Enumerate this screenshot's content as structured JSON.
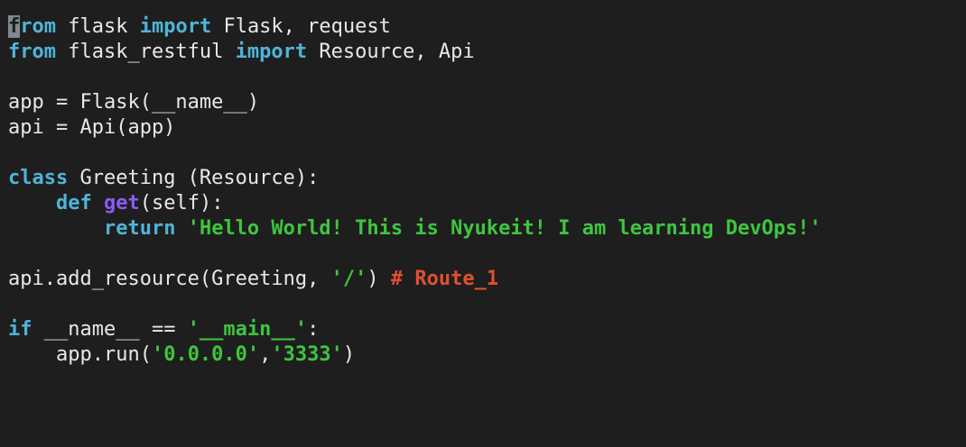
{
  "colors": {
    "background": "#1e1e1e",
    "keyword": "#4fb4d8",
    "function_name": "#8a5cf5",
    "string": "#3fc53f",
    "comment": "#e0502f",
    "text": "#e8e8e8",
    "cursor": "#7f8a8f"
  },
  "code": {
    "l1": {
      "cursor_char": "f",
      "kw1_rest": "rom",
      "t1": " flask ",
      "kw2": "import",
      "t2": " Flask, request"
    },
    "l2": {
      "kw1": "from",
      "t1": " flask_restful ",
      "kw2": "import",
      "t2": " Resource, Api"
    },
    "l4": {
      "t1": "app = Flask(__name__)"
    },
    "l5": {
      "t1": "api = Api(app)"
    },
    "l7": {
      "kw1": "class",
      "t1": " Greeting (Resource):"
    },
    "l8": {
      "indent": "    ",
      "kw1": "def",
      "sp": " ",
      "fn": "get",
      "t1": "(self):"
    },
    "l9": {
      "indent": "        ",
      "kw1": "return",
      "sp": " ",
      "str1": "'Hello World! This is Nyukeit! I am learning DevOps!'"
    },
    "l11": {
      "t1": "api.add_resource(Greeting, ",
      "str1": "'/'",
      "t2": ") ",
      "cm": "# Route_1"
    },
    "l13": {
      "kw1": "if",
      "t1": " __name__ == ",
      "str1": "'__main__'",
      "t2": ":"
    },
    "l14": {
      "indent": "    ",
      "t1": "app.run(",
      "str1": "'0.0.0.0'",
      "t2": ",",
      "str2": "'3333'",
      "t3": ")"
    }
  }
}
